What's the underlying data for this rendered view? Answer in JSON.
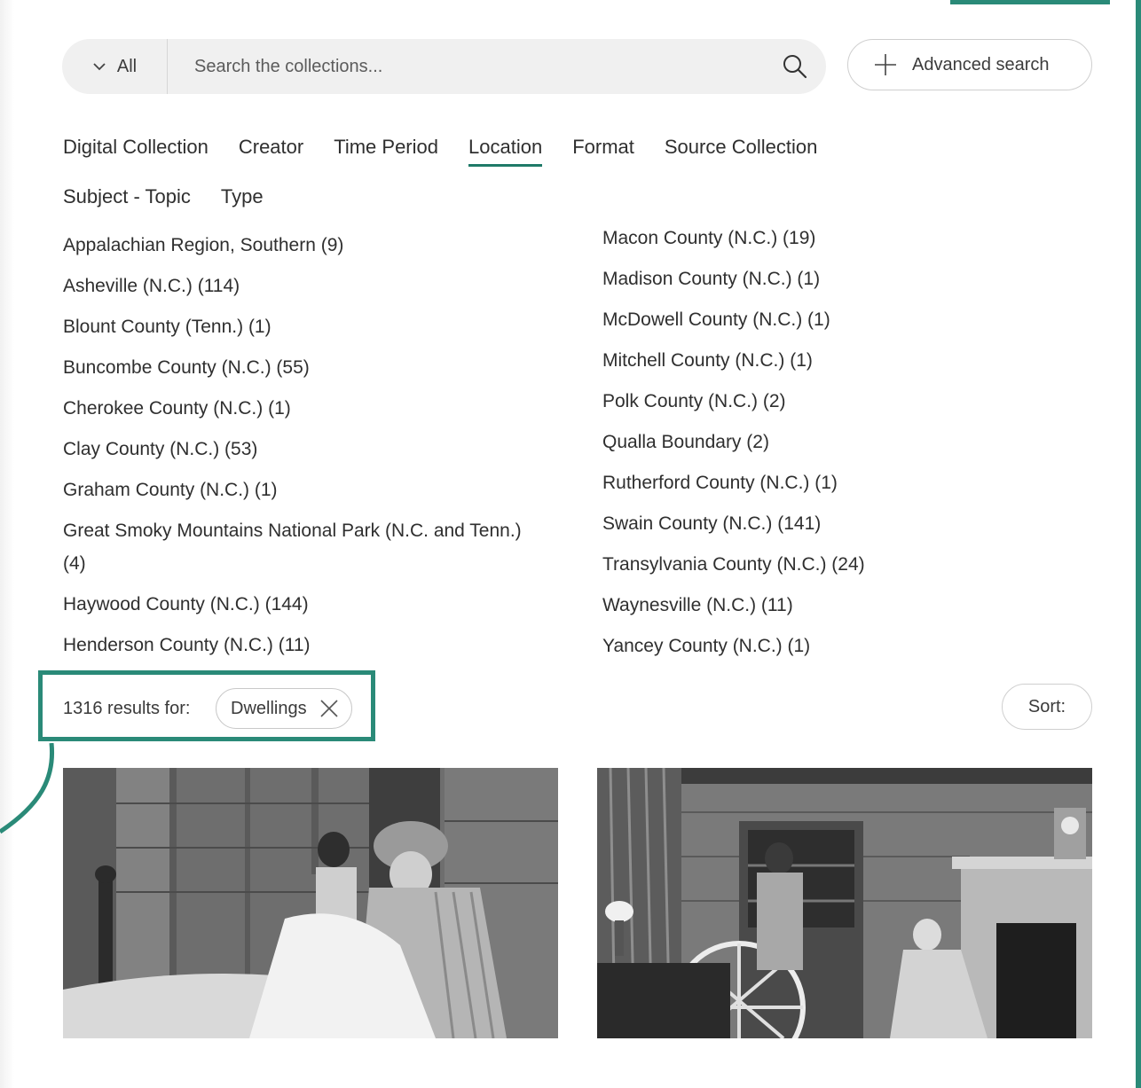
{
  "search": {
    "scope_label": "All",
    "placeholder": "Search the collections...",
    "value": "",
    "advanced_label": "Advanced search"
  },
  "tabs": [
    {
      "label": "Digital Collection"
    },
    {
      "label": "Creator"
    },
    {
      "label": "Time Period"
    },
    {
      "label": "Location",
      "active": true
    },
    {
      "label": "Format"
    },
    {
      "label": "Source Collection"
    },
    {
      "label": "Subject - Topic"
    },
    {
      "label": "Type"
    }
  ],
  "locations": {
    "left": [
      "Appalachian Region, Southern (9)",
      "Asheville (N.C.) (114)",
      "Blount County (Tenn.) (1)",
      "Buncombe County (N.C.) (55)",
      "Cherokee County (N.C.) (1)",
      "Clay County (N.C.) (53)",
      "Graham County (N.C.) (1)",
      "Great Smoky Mountains National Park (N.C. and Tenn.) (4)",
      "Haywood County (N.C.) (144)",
      "Henderson County (N.C.) (11)"
    ],
    "right": [
      "Macon County (N.C.) (19)",
      "Madison County (N.C.) (1)",
      "McDowell County (N.C.) (1)",
      "Mitchell County (N.C.) (1)",
      "Polk County (N.C.) (2)",
      "Qualla Boundary (2)",
      "Rutherford County (N.C.) (1)",
      "Swain County (N.C.) (141)",
      "Transylvania County (N.C.) (24)",
      "Waynesville (N.C.) (11)",
      "Yancey County (N.C.) (1)"
    ]
  },
  "results": {
    "count_text": "1316 results for:",
    "filter_chip": "Dwellings",
    "sort_label": "Sort:"
  },
  "colors": {
    "accent": "#1f7a68",
    "callout": "#2a8a78"
  }
}
